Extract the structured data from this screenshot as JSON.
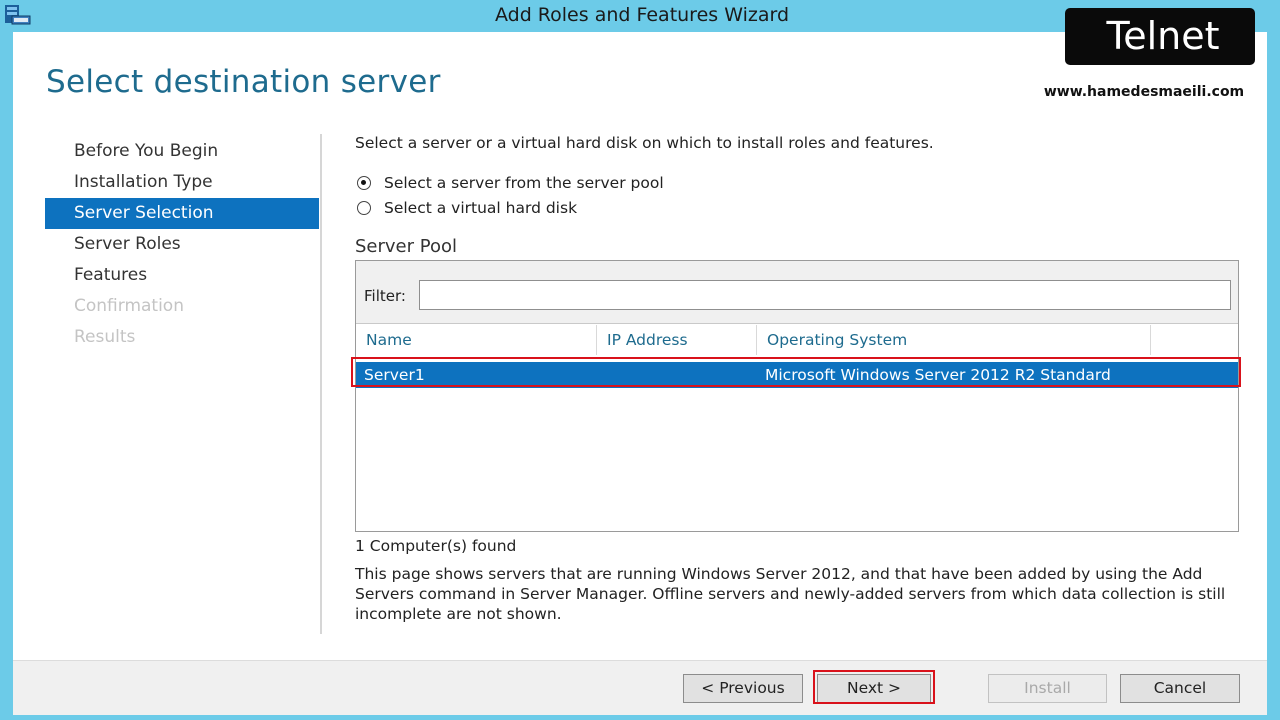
{
  "window": {
    "title": "Add Roles and Features Wizard"
  },
  "page": {
    "title": "Select destination server"
  },
  "nav": {
    "items": [
      {
        "label": "Before You Begin",
        "state": "normal"
      },
      {
        "label": "Installation Type",
        "state": "normal"
      },
      {
        "label": "Server Selection",
        "state": "active"
      },
      {
        "label": "Server Roles",
        "state": "normal"
      },
      {
        "label": "Features",
        "state": "normal"
      },
      {
        "label": "Confirmation",
        "state": "disabled"
      },
      {
        "label": "Results",
        "state": "disabled"
      }
    ]
  },
  "content": {
    "intro": "Select a server or a virtual hard disk on which to install roles and features.",
    "radio_pool": "Select a server from the server pool",
    "radio_vhd": "Select a virtual hard disk",
    "selected_option": "pool",
    "pool_heading": "Server Pool",
    "filter_label": "Filter:",
    "filter_value": "",
    "columns": [
      "Name",
      "IP Address",
      "Operating System"
    ],
    "rows": [
      {
        "name": "Server1",
        "ip": "",
        "os": "Microsoft Windows Server 2012 R2 Standard"
      }
    ],
    "found": "1 Computer(s) found",
    "note": "This page shows servers that are running Windows Server 2012, and that have been added by using the Add Servers command in Server Manager. Offline servers and newly-added servers from which data collection is still incomplete are not shown."
  },
  "buttons": {
    "previous": "< Previous",
    "next": "Next >",
    "install": "Install",
    "cancel": "Cancel"
  },
  "watermark": {
    "logo": "Telnet",
    "url": "www.hamedesmaeili.com"
  },
  "colors": {
    "frame": "#6ccbe8",
    "accent": "#0d72bf",
    "title": "#1e6b8e",
    "highlight": "#d9121b"
  }
}
